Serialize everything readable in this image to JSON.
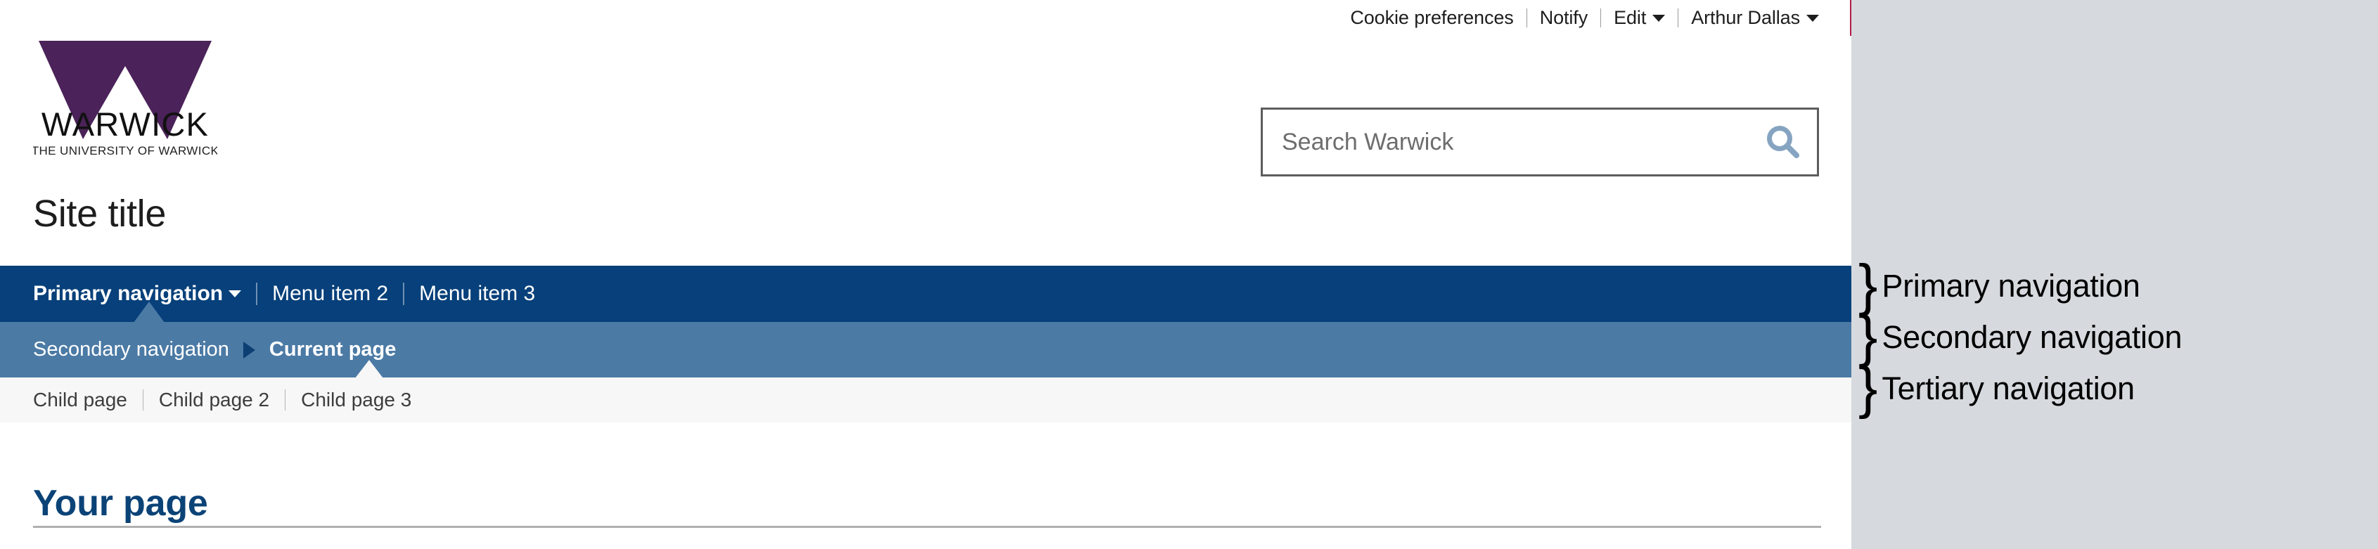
{
  "utility_bar": {
    "links": [
      {
        "label": "Cookie preferences",
        "caret": false
      },
      {
        "label": "Notify",
        "caret": false
      },
      {
        "label": "Edit",
        "caret": true
      },
      {
        "label": "Arthur Dallas",
        "caret": true
      }
    ]
  },
  "brand": {
    "wordmark": "WARWICK",
    "strapline": "THE UNIVERSITY OF WARWICK",
    "logo_color": "#4b2259"
  },
  "search": {
    "placeholder": "Search Warwick",
    "value": "",
    "icon": "search-icon",
    "icon_color": "#86a4c1"
  },
  "site": {
    "title": "Site title"
  },
  "primary_nav": {
    "background": "#07407a",
    "items": [
      {
        "label": "Primary navigation",
        "active": true,
        "caret": true
      },
      {
        "label": "Menu item 2",
        "active": false,
        "caret": false
      },
      {
        "label": "Menu item 3",
        "active": false,
        "caret": false
      }
    ]
  },
  "secondary_nav": {
    "background": "#4b7aa5",
    "parent": "Secondary navigation",
    "separator_icon": "triangle-right-icon",
    "current": "Current page"
  },
  "tertiary_nav": {
    "background": "#f7f7f8",
    "items": [
      {
        "label": "Child page"
      },
      {
        "label": "Child page 2"
      },
      {
        "label": "Child page 3"
      }
    ]
  },
  "content": {
    "heading": "Your page",
    "heading_color": "#0b4377"
  },
  "annotations": {
    "brace": "}",
    "rows": [
      {
        "label": "Primary navigation"
      },
      {
        "label": "Secondary navigation"
      },
      {
        "label": "Tertiary navigation"
      }
    ]
  }
}
